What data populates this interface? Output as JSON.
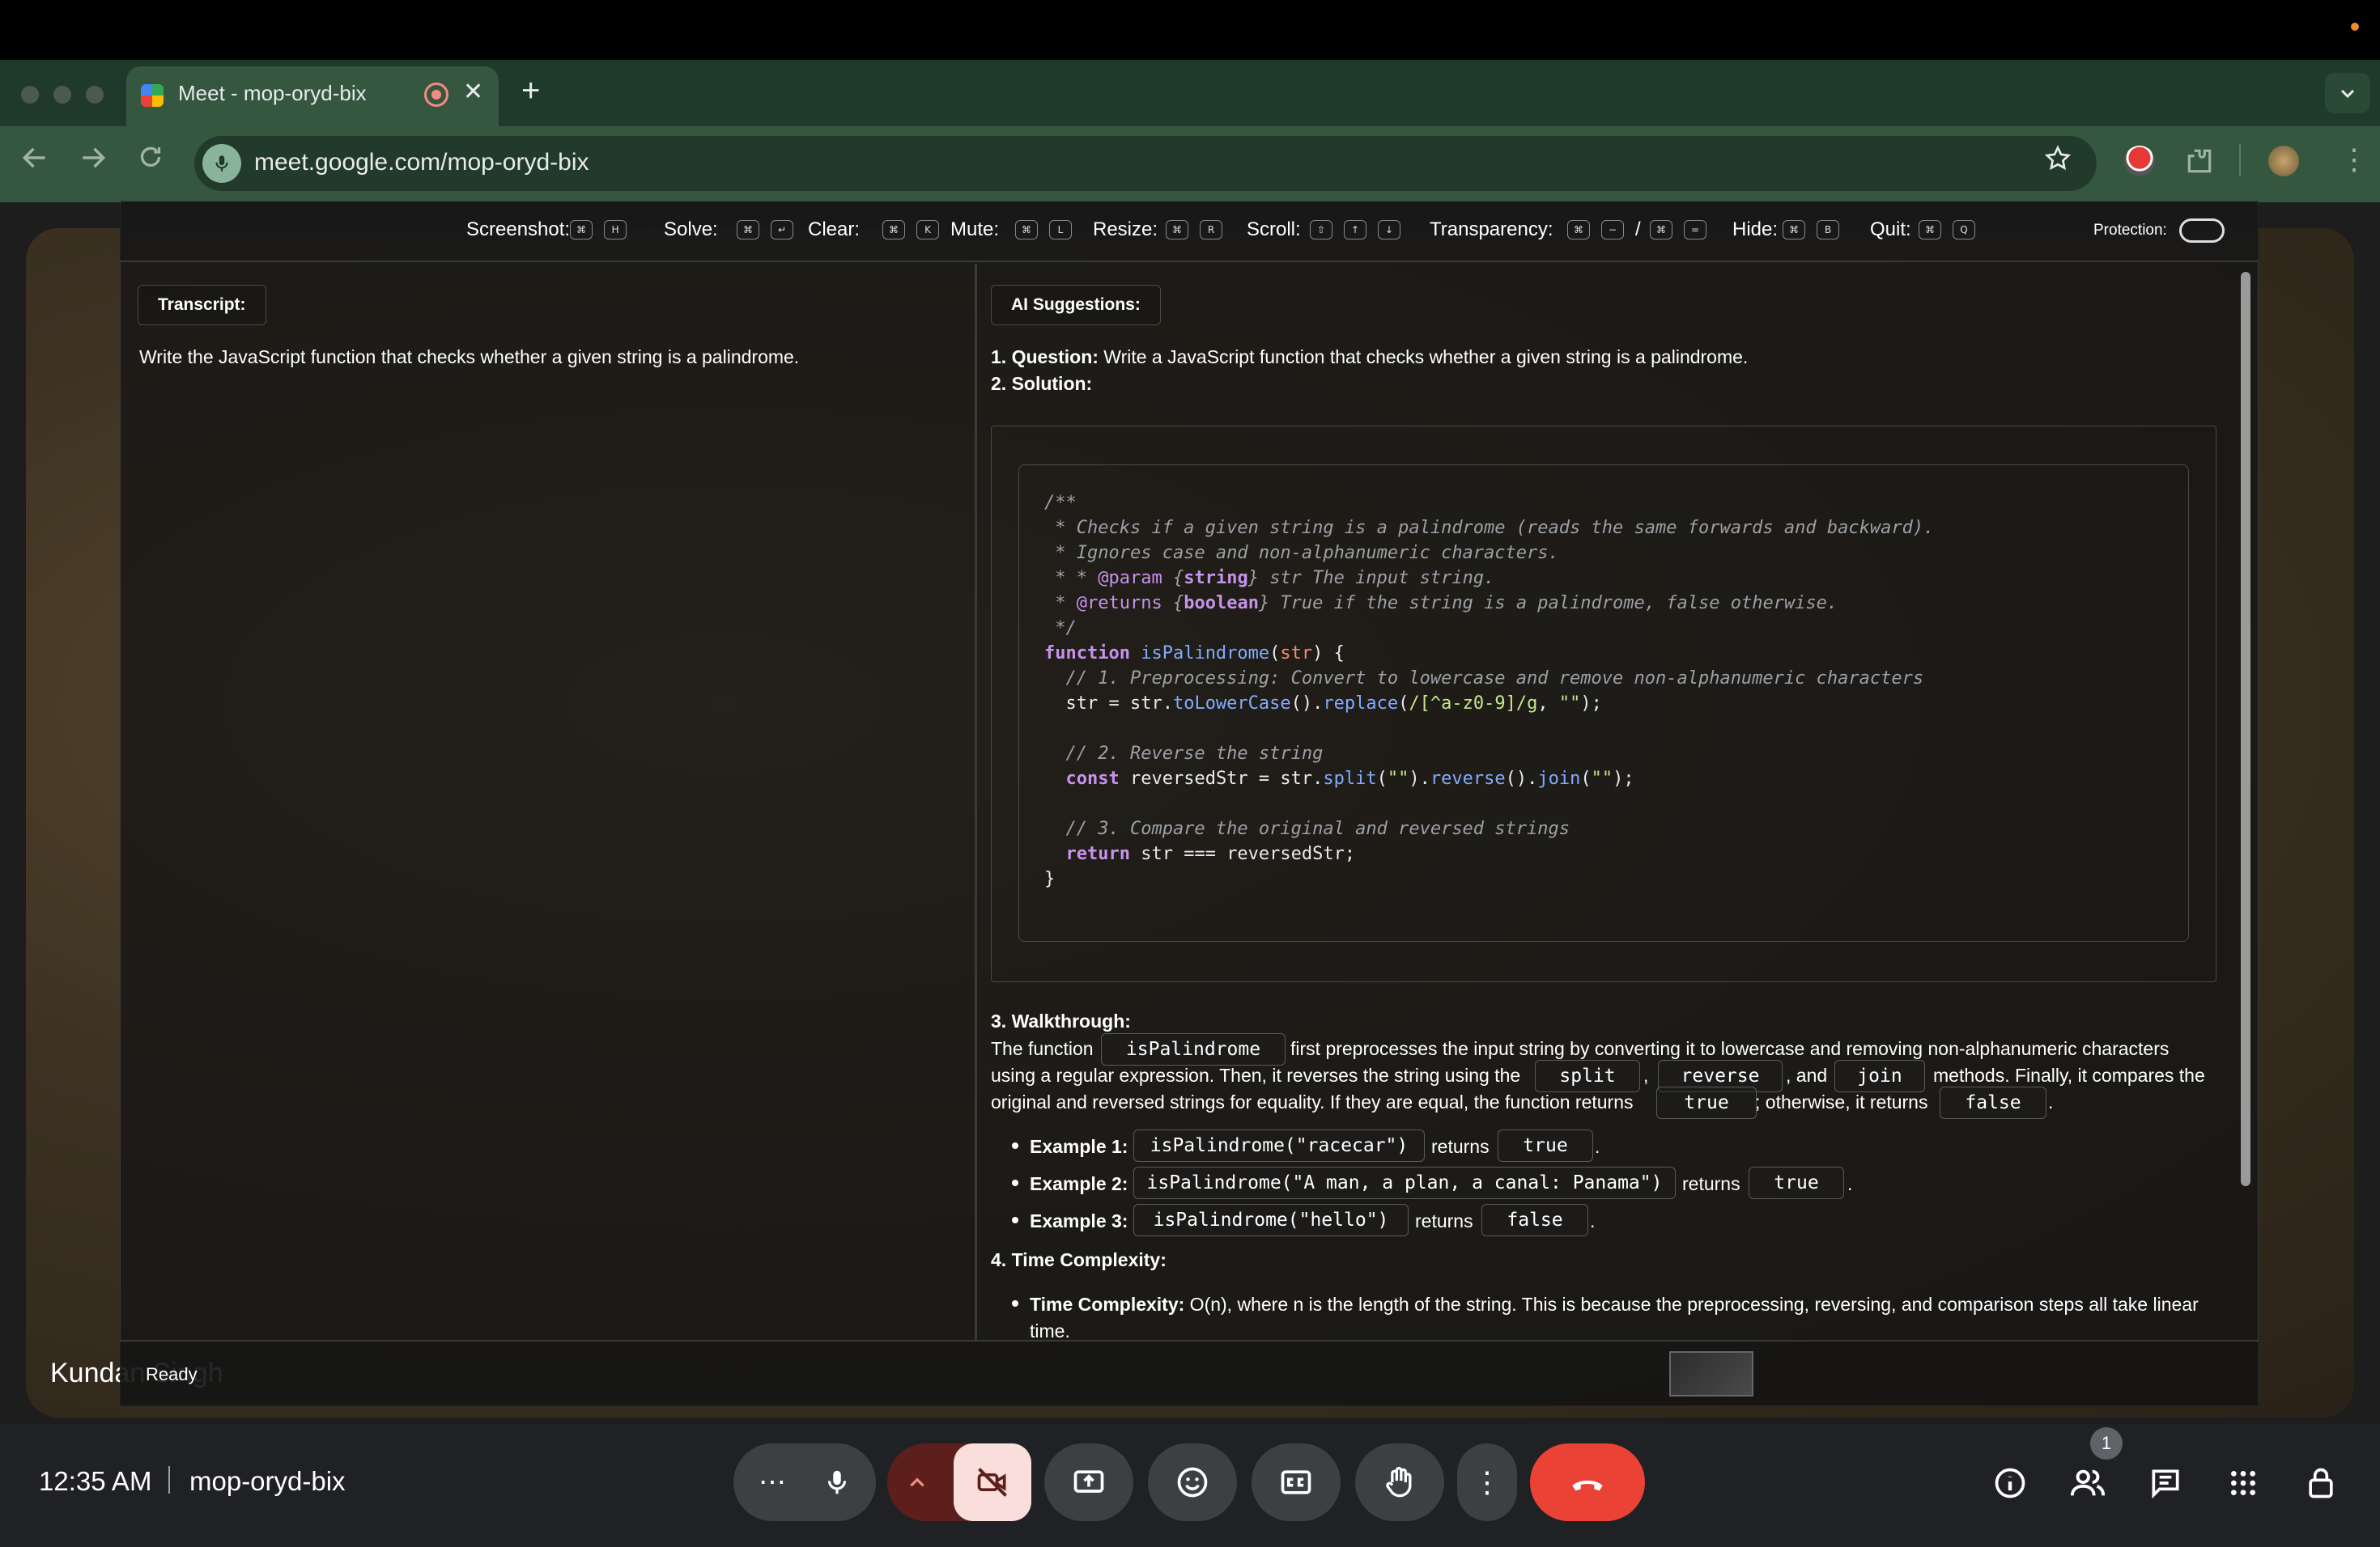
{
  "browser": {
    "tab_title": "Meet - mop-oryd-bix",
    "tab_close": "✕",
    "new_tab": "+",
    "url": "meet.google.com/mop-oryd-bix"
  },
  "shortcuts": [
    {
      "label": "Screenshot:",
      "keys": [
        "⌘",
        "H"
      ]
    },
    {
      "label": "Solve:",
      "keys": [
        "⌘",
        "↵"
      ]
    },
    {
      "label": "Clear:",
      "keys": [
        "⌘",
        "K"
      ]
    },
    {
      "label": "Mute:",
      "keys": [
        "⌘",
        "L"
      ]
    },
    {
      "label": "Resize:",
      "keys": [
        "⌘",
        "R"
      ]
    },
    {
      "label": "Scroll:",
      "keys": [
        "⇧",
        "↑",
        "↓"
      ]
    },
    {
      "label": "Transparency:",
      "keys": [
        "⌘",
        "−",
        "/",
        "⌘",
        "="
      ]
    },
    {
      "label": "Hide:",
      "keys": [
        "⌘",
        "B"
      ]
    },
    {
      "label": "Quit:",
      "keys": [
        "⌘",
        "Q"
      ]
    }
  ],
  "protection_label": "Protection:",
  "transcript": {
    "label": "Transcript:",
    "text": "Write the JavaScript function that checks whether a given string is a palindrome."
  },
  "suggestions": {
    "label": "AI Suggestions:",
    "q_num": "1. Question:",
    "q_text": " Write a JavaScript function that checks whether a given string is a palindrome.",
    "sol": "2. Solution:",
    "walk_title": "3. Walkthrough:",
    "walk_l1a": "The function",
    "walk_l1b": "first preprocesses the input string by converting it to lowercase and removing non-alphanumeric characters",
    "walk_l2a": "using a regular expression. Then, it reverses the string using the",
    "walk_l2b": ",",
    "walk_l2c": ", and",
    "walk_l2d": "methods. Finally, it compares the",
    "walk_l3a": "original and reversed strings for equality. If they are equal, the function returns",
    "walk_l3b": "; otherwise, it returns",
    "walk_l3c": ".",
    "chips": {
      "isPalindrome": "isPalindrome",
      "split": "split",
      "reverse": "reverse",
      "join": "join",
      "true": "true",
      "false": "false"
    },
    "examples": [
      {
        "label": "Example 1:",
        "call": "isPalindrome(\"racecar\")",
        "returns": "returns",
        "result": "true",
        "end": "."
      },
      {
        "label": "Example 2:",
        "call": "isPalindrome(\"A man, a plan, a canal: Panama\")",
        "returns": "returns",
        "result": "true",
        "end": "."
      },
      {
        "label": "Example 3:",
        "call": "isPalindrome(\"hello\")",
        "returns": "returns",
        "result": "false",
        "end": "."
      }
    ],
    "tc_title": "4. Time Complexity:",
    "tc_label": "Time Complexity:",
    "tc_text1": " O(n), where n is the length of the string. This is because the preprocessing, reversing, and comparison steps all take linear",
    "tc_text2": "time."
  },
  "code_lines": [
    "/**",
    " * Checks if a given string is a palindrome (reads the same forwards and backward).",
    " * Ignores case and non-alphanumeric characters.",
    " * * @param {string} str The input string.",
    " * @returns {boolean} True if the string is a palindrome, false otherwise.",
    " */",
    "function isPalindrome(str) {",
    "  // 1. Preprocessing: Convert to lowercase and remove non-alphanumeric characters",
    "  str = str.toLowerCase().replace(/[^a-z0-9]/g, \"\");",
    "",
    "  // 2. Reverse the string",
    "  const reversedStr = str.split(\"\").reverse().join(\"\");",
    "",
    "  // 3. Compare the original and reversed strings",
    "  return str === reversedStr;",
    "}"
  ],
  "status": "Ready",
  "participant_name": "Kundan Singh",
  "meeting": {
    "time": "12:35 AM",
    "code": "mop-oryd-bix",
    "participants_badge": "1"
  },
  "icons": [
    "chevron-down-icon",
    "back-icon",
    "forward-icon",
    "reload-icon",
    "mic-icon",
    "star-icon",
    "extensions-icon",
    "profile-avatar",
    "more-vert-icon",
    "camera-off-icon",
    "present-icon",
    "emoji-icon",
    "captions-icon",
    "raise-hand-icon",
    "end-call-icon",
    "info-icon",
    "people-icon",
    "chat-icon",
    "apps-icon",
    "lock-icon"
  ],
  "colors": {
    "end_call": "#ea4335",
    "camera_off": "#f9dedc",
    "chrome_frame": "#35573f"
  }
}
